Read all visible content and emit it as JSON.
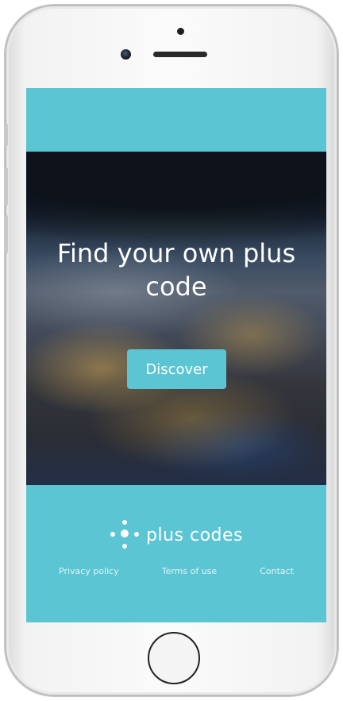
{
  "hero": {
    "title": "Find your own plus code",
    "button_label": "Discover"
  },
  "footer": {
    "logo_text": "plus codes",
    "links": [
      {
        "label": "Privacy policy"
      },
      {
        "label": "Terms of use"
      },
      {
        "label": "Contact"
      }
    ]
  },
  "colors": {
    "brand_teal": "#5bc5d3",
    "text": "#ffffff"
  },
  "icons": {
    "logo": "plus-codes-dot-mark",
    "home": "home-button"
  }
}
